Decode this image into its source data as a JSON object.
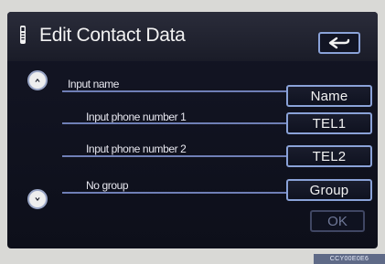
{
  "app": {
    "title": "Edit Contact Data",
    "back_icon": "back-arrow-icon",
    "phone_icon": "phone-icon"
  },
  "rows": [
    {
      "label": "Input name",
      "button": "Name"
    },
    {
      "label": "Input phone number 1",
      "button": "TEL1"
    },
    {
      "label": "Input phone number 2",
      "button": "TEL2"
    },
    {
      "label": "No group",
      "button": "Group"
    }
  ],
  "controls": {
    "scroll_up_icon": "up-arrow-icon",
    "scroll_down_icon": "down-arrow-icon",
    "ok_label": "OK"
  },
  "watermark": "CCY00E0E6",
  "colors": {
    "screen_bg": "#141625",
    "line": "#6f7fb6",
    "button_border": "#8aa2d8",
    "text": "#e7e7ef",
    "ok_disabled": "#6f7898"
  }
}
